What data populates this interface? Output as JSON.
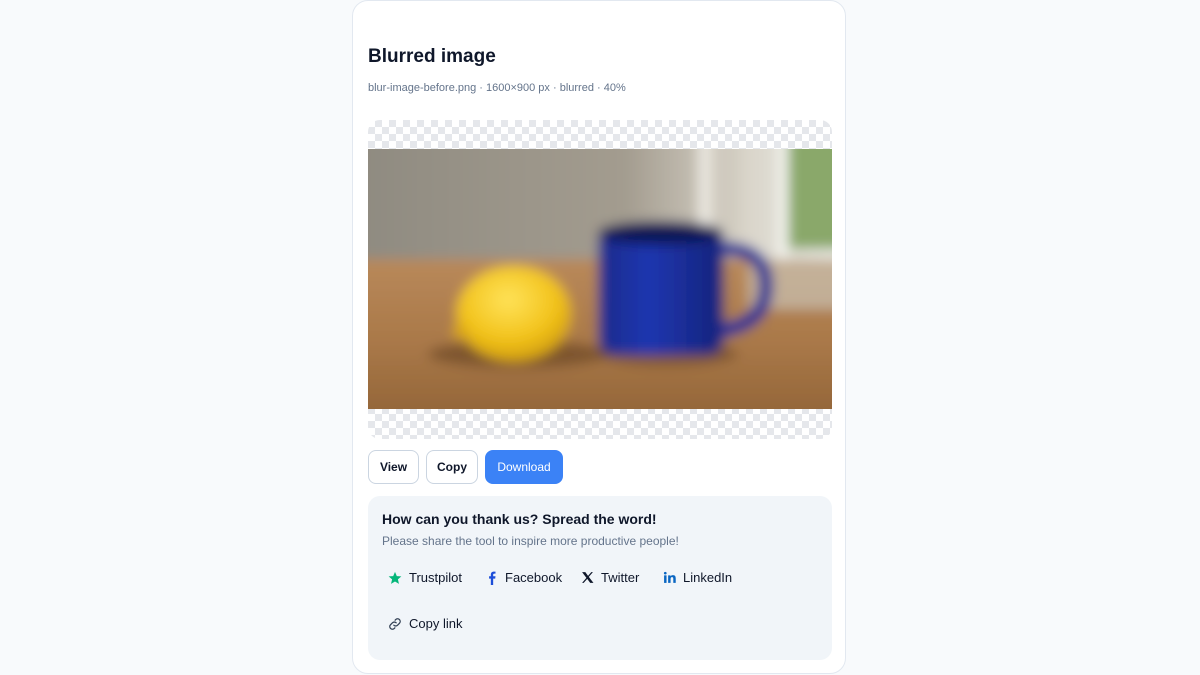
{
  "result": {
    "title": "Blurred image",
    "meta": "blur-image-before.png · 1600×900 px · blurred · 40%"
  },
  "actions": {
    "view_label": "View",
    "copy_label": "Copy",
    "download_label": "Download"
  },
  "share": {
    "title": "How can you thank us? Spread the word!",
    "subtitle": "Please share the tool to inspire more productive people!",
    "links": [
      {
        "label": "Trustpilot",
        "icon": "star-icon",
        "color": "#04b67a"
      },
      {
        "label": "Facebook",
        "icon": "facebook-icon",
        "color": "#1d4ed8"
      },
      {
        "label": "Twitter",
        "icon": "x-icon",
        "color": "#0f172a"
      },
      {
        "label": "LinkedIn",
        "icon": "linkedin-icon",
        "color": "#0a66c2"
      },
      {
        "label": "Copy link",
        "icon": "link-icon",
        "color": "#334155"
      }
    ]
  },
  "colors": {
    "accent": "#3b82f6",
    "page_background": "#f8fafc",
    "share_background": "#f1f5f9"
  }
}
